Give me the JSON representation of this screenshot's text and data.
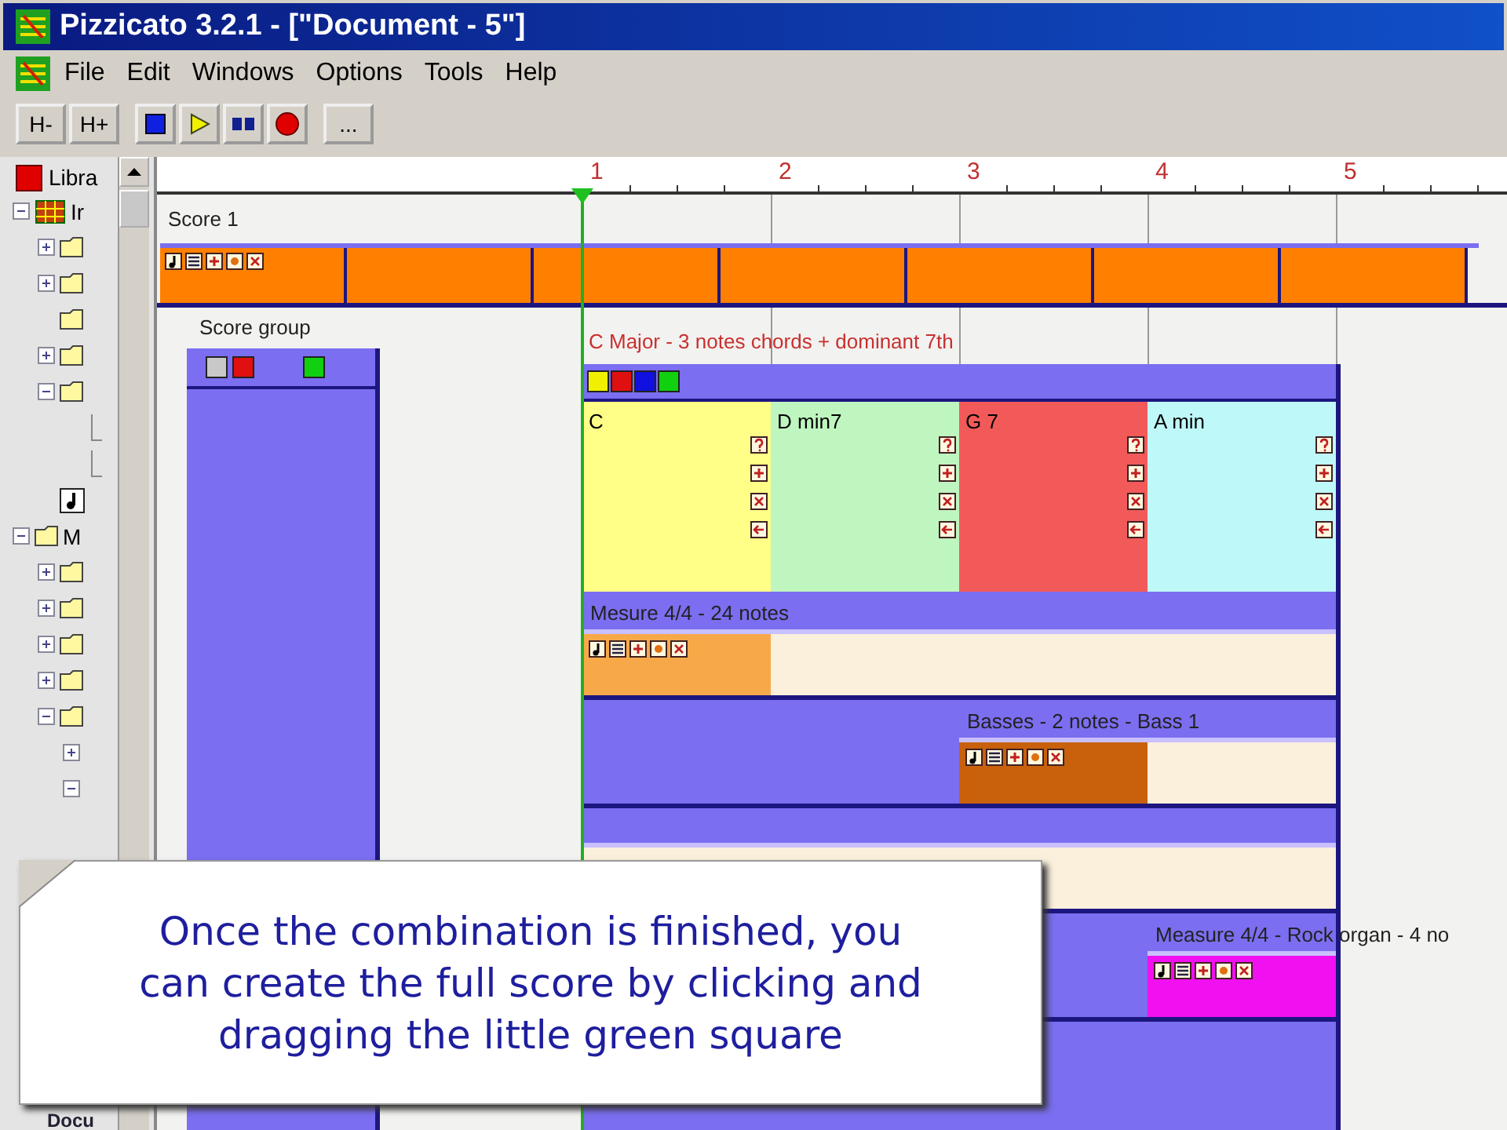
{
  "window": {
    "title": "Pizzicato 3.2.1 - [\"Document - 5\"]"
  },
  "menu": [
    "File",
    "Edit",
    "Windows",
    "Options",
    "Tools",
    "Help"
  ],
  "toolbar": [
    {
      "kind": "text",
      "label": "H-"
    },
    {
      "kind": "text",
      "label": "H+"
    },
    {
      "kind": "stop"
    },
    {
      "kind": "play"
    },
    {
      "kind": "pause"
    },
    {
      "kind": "record"
    },
    {
      "kind": "text",
      "label": "..."
    }
  ],
  "library": {
    "title": "Libra",
    "footer": "Docu",
    "tree": [
      {
        "label": "Ir",
        "kind": "grid",
        "expanded": true,
        "children": [
          {
            "kind": "folder",
            "expanded": false
          },
          {
            "kind": "folder",
            "expanded": false
          },
          {
            "kind": "folder"
          },
          {
            "kind": "folder",
            "expanded": false
          },
          {
            "kind": "folder",
            "expanded": true,
            "children": [
              {
                "kind": "line"
              },
              {
                "kind": "line"
              }
            ]
          },
          {
            "kind": "note"
          }
        ]
      },
      {
        "label": "M",
        "kind": "folder",
        "expanded": true,
        "children": [
          {
            "kind": "folder",
            "expanded": false
          },
          {
            "kind": "folder",
            "expanded": false
          },
          {
            "kind": "folder",
            "expanded": false
          },
          {
            "kind": "folder",
            "expanded": false
          },
          {
            "kind": "folder",
            "expanded": true,
            "children": [
              {
                "kind": "none",
                "expanded": false
              },
              {
                "kind": "none",
                "expanded": true
              }
            ]
          }
        ]
      }
    ]
  },
  "ruler": [
    "1",
    "2",
    "3",
    "4",
    "5"
  ],
  "score": {
    "title": "Score 1"
  },
  "score_group": {
    "title": "Score group",
    "swatches": [
      {
        "color": "#c8c8c8"
      },
      {
        "color": "#e01010"
      },
      {
        "color": "#10d010"
      }
    ]
  },
  "chords": {
    "title": "C Major - 3 notes chords + dominant 7th",
    "swatches": [
      {
        "color": "#f0f000"
      },
      {
        "color": "#e01010"
      },
      {
        "color": "#1010e0"
      },
      {
        "color": "#10d010"
      }
    ],
    "items": [
      {
        "name": "C",
        "color": "#ffff88"
      },
      {
        "name": "D min7",
        "color": "#bff5bf"
      },
      {
        "name": "G 7",
        "color": "#f25a5a"
      },
      {
        "name": "A min",
        "color": "#bff8f8"
      }
    ]
  },
  "tracks": [
    {
      "title": "Mesure 4/4 - 24 notes",
      "color": "#f7a94a",
      "cells": [
        {
          "kind": "head"
        },
        {
          "kind": "body"
        },
        {
          "kind": "body"
        },
        {
          "kind": "body"
        }
      ]
    },
    {
      "title": "Basses - 2 notes - Bass 1",
      "color": "#c8600c",
      "cells": [
        {
          "kind": "empty"
        },
        {
          "kind": "empty"
        },
        {
          "kind": "head"
        },
        {
          "kind": "body"
        }
      ]
    },
    {
      "cells": [
        {
          "kind": "body"
        },
        {
          "kind": "body"
        },
        {
          "kind": "body"
        },
        {
          "kind": "body"
        }
      ]
    },
    {
      "title": "Measure 4/4 - Rock organ - 4 no",
      "color": "#f010f0",
      "cells": [
        {
          "kind": "empty"
        },
        {
          "kind": "empty"
        },
        {
          "kind": "empty"
        },
        {
          "kind": "head"
        }
      ]
    }
  ],
  "callout": {
    "lines": [
      "Once the combination is finished, you",
      "can create the full score by clicking and",
      "dragging the little green square"
    ]
  }
}
